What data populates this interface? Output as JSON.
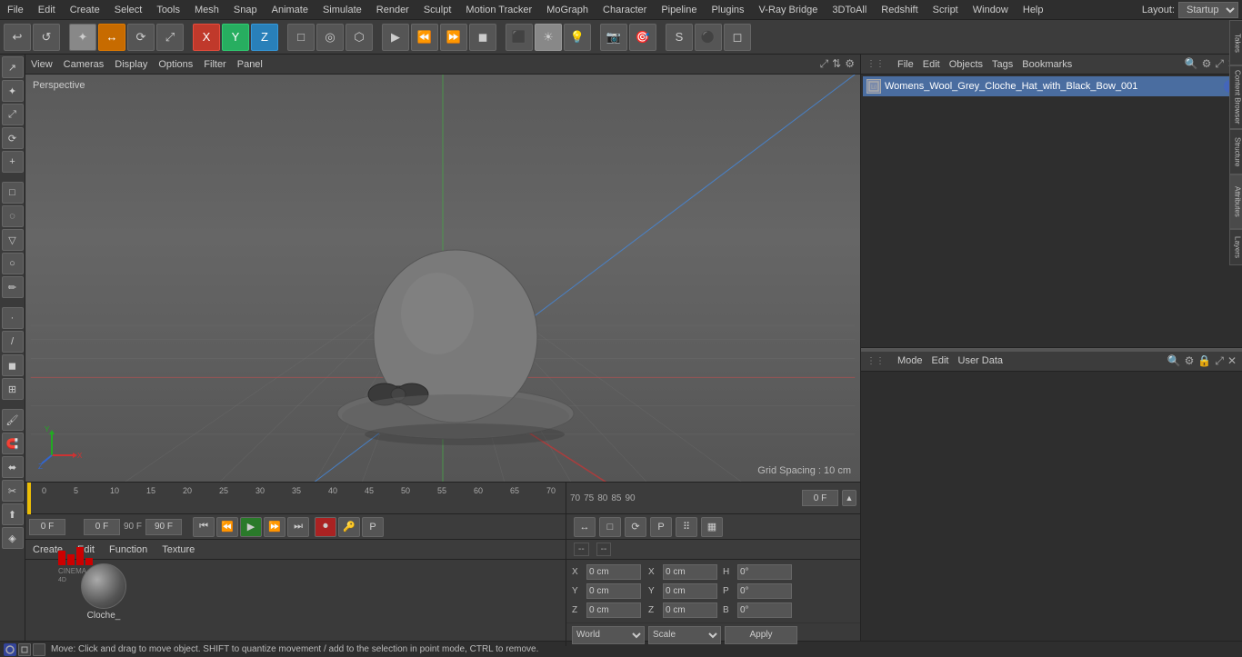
{
  "menubar": {
    "items": [
      "File",
      "Edit",
      "Create",
      "Select",
      "Tools",
      "Mesh",
      "Snap",
      "Animate",
      "Simulate",
      "Render",
      "Sculpt",
      "Motion Tracker",
      "MoGraph",
      "Character",
      "Pipeline",
      "Plugins",
      "V-Ray Bridge",
      "3DToAll",
      "Redshift",
      "Script",
      "Window",
      "Help"
    ],
    "layout_label": "Layout:",
    "layout_value": "Startup"
  },
  "toolbar": {
    "buttons": [
      "↩",
      "↺",
      "↗",
      "↕",
      "⟳",
      "+",
      "X",
      "Y",
      "Z",
      "□",
      "◎",
      "⬡",
      "▶",
      "⏪",
      "⏩",
      "◼",
      "⬛",
      "🎬",
      "⬡",
      "⊕",
      "S",
      "⚫",
      "◻",
      "○",
      "⭕",
      "P",
      "⠿",
      "▦"
    ]
  },
  "viewport": {
    "header_menus": [
      "View",
      "Cameras",
      "Display",
      "Options",
      "Filter",
      "Panel"
    ],
    "label": "Perspective",
    "grid_spacing": "Grid Spacing : 10 cm"
  },
  "timeline": {
    "marks": [
      0,
      5,
      10,
      15,
      20,
      25,
      30,
      35,
      40,
      45,
      50,
      55,
      60,
      65,
      70,
      75,
      80,
      85,
      90
    ],
    "start_frame": "0 F",
    "end_frame": "90 F",
    "current_frame": "0 F",
    "preview_start": "0 F",
    "preview_end": "90 F"
  },
  "object_manager": {
    "menus": [
      "File",
      "Edit",
      "Objects",
      "Tags",
      "Bookmarks"
    ],
    "object_name": "Womens_Wool_Grey_Cloche_Hat_with_Black_Bow_001"
  },
  "attributes": {
    "menus": [
      "Mode",
      "Edit",
      "User Data"
    ]
  },
  "material_panel": {
    "menus": [
      "Create",
      "Edit",
      "Function",
      "Texture"
    ],
    "material_name": "Cloche_"
  },
  "coordinates": {
    "header_items": [
      "--",
      "--"
    ],
    "x_pos": "0 cm",
    "y_pos": "0 cm",
    "z_pos": "0 cm",
    "x_size": "0 cm",
    "y_size": "0 cm",
    "z_size": "0 cm",
    "h_rot": "0°",
    "p_rot": "0°",
    "b_rot": "0°",
    "world_label": "World",
    "scale_label": "Scale",
    "apply_label": "Apply"
  },
  "status_bar": {
    "text": "Move: Click and drag to move object. SHIFT to quantize movement / add to the selection in point mode, CTRL to remove."
  },
  "right_tabs": [
    "Takes",
    "Content Browser",
    "Structure",
    "Attributes",
    "Layers"
  ]
}
